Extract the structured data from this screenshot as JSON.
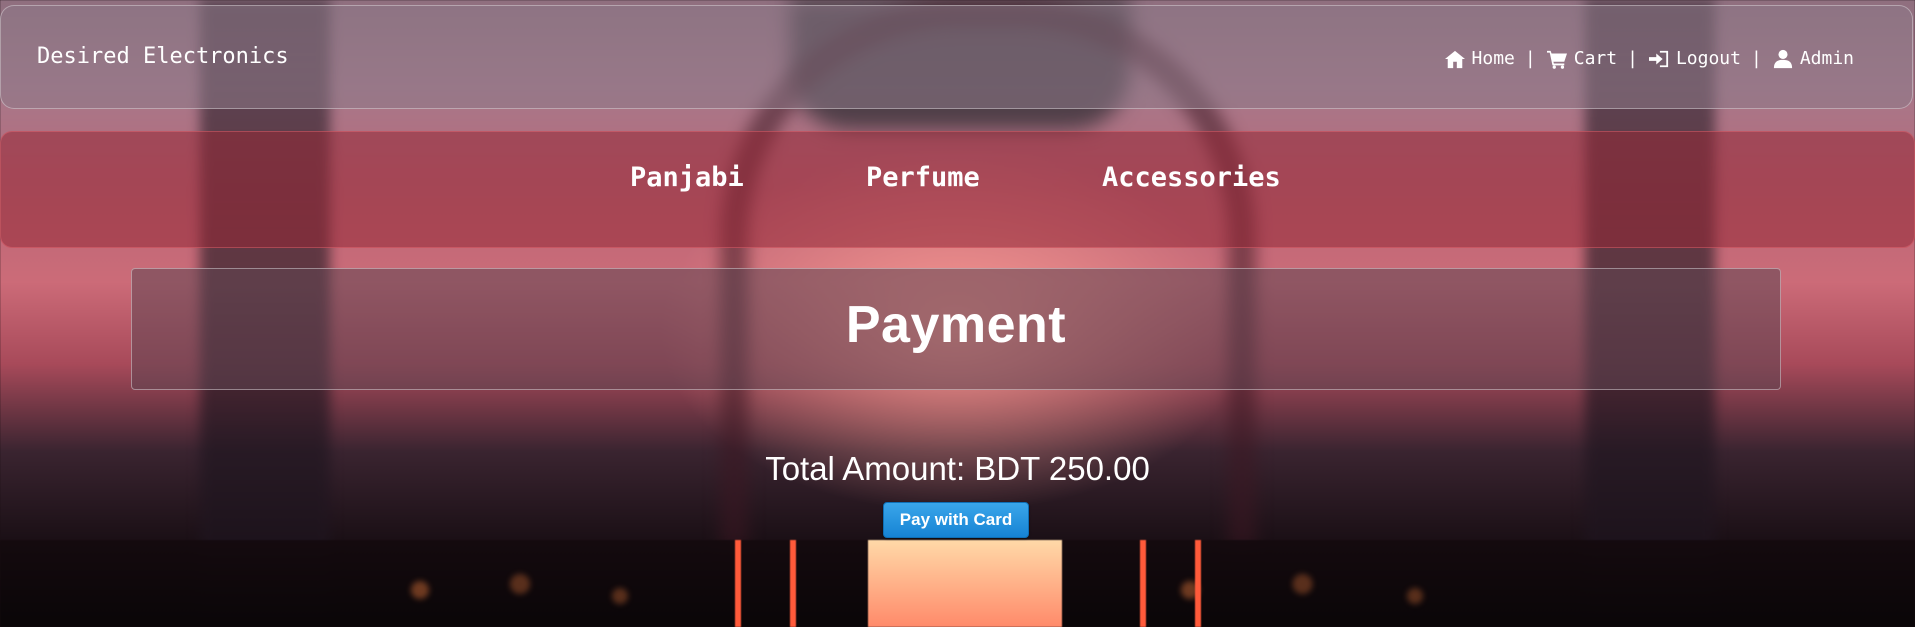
{
  "brand": {
    "title": "Desired Electronics"
  },
  "top_nav": {
    "items": [
      {
        "label": "Home",
        "icon": "home-icon"
      },
      {
        "label": "Cart",
        "icon": "cart-icon"
      },
      {
        "label": "Logout",
        "icon": "logout-icon"
      },
      {
        "label": "Admin",
        "icon": "user-icon"
      }
    ],
    "separator": "|"
  },
  "categories": {
    "items": [
      {
        "label": "Panjabi"
      },
      {
        "label": "Perfume"
      },
      {
        "label": "Accessories"
      }
    ]
  },
  "main": {
    "title": "Payment",
    "total_text": "Total Amount: BDT 250.00",
    "pay_button_label": "Pay with Card"
  },
  "colors": {
    "pay_button": "#1f8fde",
    "category_bar": "#962837",
    "text": "#ffffff"
  }
}
